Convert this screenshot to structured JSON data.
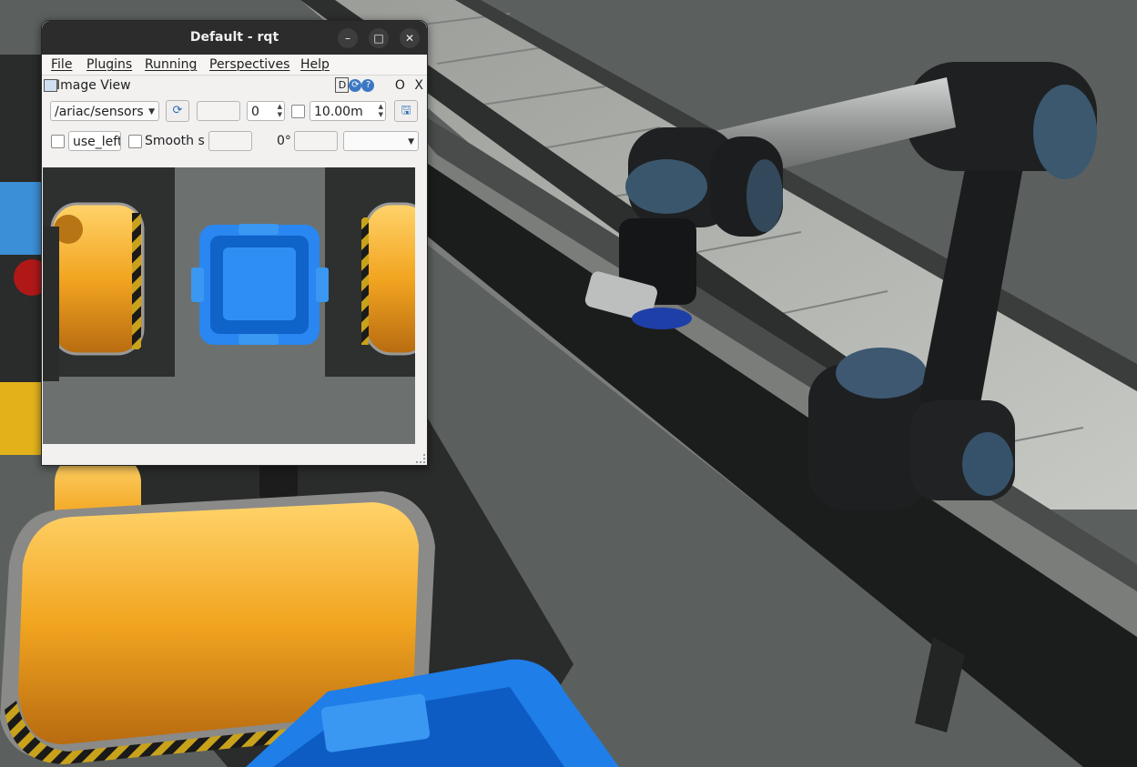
{
  "window": {
    "title": "Default - rqt",
    "minimize": "–",
    "maximize": "□",
    "close": "✕"
  },
  "menu": [
    {
      "label": "File"
    },
    {
      "label": "Plugins"
    },
    {
      "label": "Running"
    },
    {
      "label": "Perspectives"
    },
    {
      "label": "Help"
    }
  ],
  "plugin": {
    "title": "Image View",
    "d_label": "D",
    "o_label": "O",
    "x_label": "X"
  },
  "toolbar": {
    "topic": "/ariac/sensors",
    "refresh_icon": "refresh-icon",
    "blank_field": "",
    "number_value": "0",
    "max_range": "10.00m",
    "save_icon": "save-icon"
  },
  "toolbar2": {
    "use_left_value": "use_left",
    "smooth_label": "Smooth s",
    "blank_field": "",
    "rotation": "0°",
    "rotation_field": "",
    "select_value": ""
  },
  "colors": {
    "titlebar": "#2c2c2c",
    "bin_blue": "#2a86f0",
    "gripper_orange": "#f2a520",
    "floor": "#5a5f5d",
    "robot_dark": "#1f2124",
    "robot_cap": "#3c5a73"
  }
}
